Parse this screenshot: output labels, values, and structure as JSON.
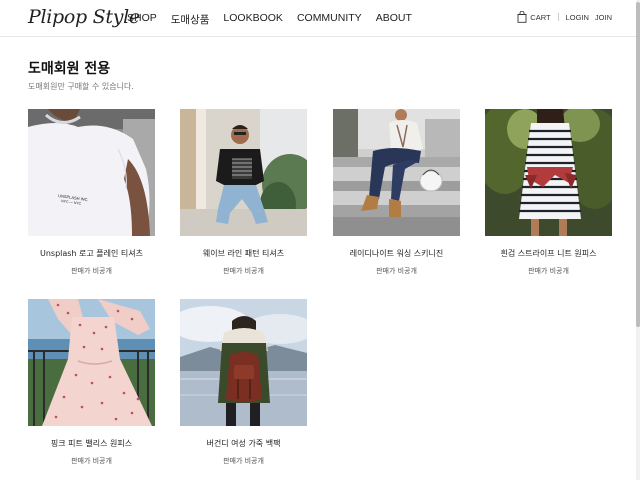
{
  "header": {
    "logo": "Plipop Style",
    "nav": [
      "SHOP",
      "도매상품",
      "LOOKBOOK",
      "COMMUNITY",
      "ABOUT"
    ],
    "cart_label": "CART",
    "login_label": "LOGIN",
    "join_label": "JOIN"
  },
  "page": {
    "title": "도매회원 전용",
    "subtitle": "도매회원만 구매할 수 있습니다."
  },
  "products": [
    {
      "name": "Unsplash 로고 플레인 티셔츠",
      "price": "판매가 비공개",
      "shirt_text": "UNSPLASH INC.\nNYC — NYC"
    },
    {
      "name": "웨이브 라인 패턴 티셔츠",
      "price": "판매가 비공개"
    },
    {
      "name": "레이디나이트 워싱 스키니진",
      "price": "판매가 비공개"
    },
    {
      "name": "흰검 스트라이프 니트 원피스",
      "price": "판매가 비공개"
    },
    {
      "name": "핑크 피트 밸리스 원피스",
      "price": "판매가 비공개"
    },
    {
      "name": "버건디 여성 가죽 백팩",
      "price": "판매가 비공개"
    }
  ],
  "colors": {
    "accent": "#222222",
    "border": "#e6e6e6",
    "muted": "#777777"
  }
}
